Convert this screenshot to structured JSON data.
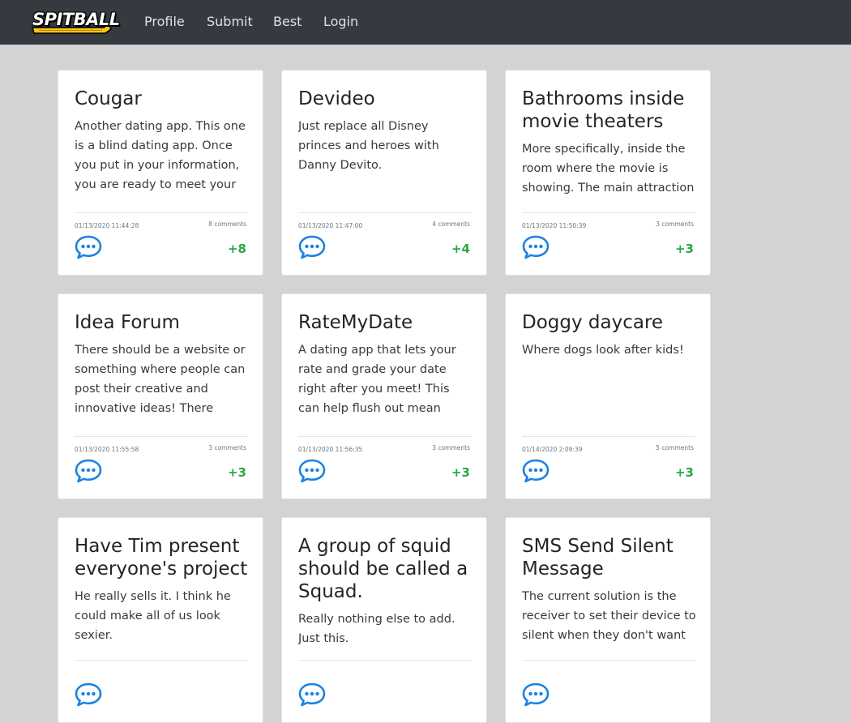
{
  "nav": {
    "logo_text": "SPITBALL",
    "links": [
      "Profile",
      "Submit",
      "Best",
      "Login"
    ]
  },
  "colors": {
    "navbar": "#343a40",
    "background": "#d3d3d3",
    "accent_blue": "#1a82e2",
    "score_green": "#28a745",
    "logo_yellow": "#f5c518"
  },
  "cards": [
    {
      "title": "Cougar",
      "text": "Another dating app. This one is a blind dating app. Once you put in your information, you are ready to meet your",
      "date": "01/13/2020 11:44:28",
      "comments": "8 comments",
      "score": "+8"
    },
    {
      "title": "Devideo",
      "text": "Just replace all Disney princes and heroes with Danny Devito.",
      "date": "01/13/2020 11:47:00",
      "comments": "4 comments",
      "score": "+4"
    },
    {
      "title": "Bathrooms inside movie theaters",
      "text": "More specifically, inside the room where the movie is showing. The main attraction",
      "date": "01/13/2020 11:50:39",
      "comments": "3 comments",
      "score": "+3"
    },
    {
      "title": "Idea Forum",
      "text": "There should be a website or something where people can post their creative and innovative ideas! There would",
      "date": "01/13/2020 11:55:58",
      "comments": "3 comments",
      "score": "+3"
    },
    {
      "title": "RateMyDate",
      "text": "A dating app that lets your rate and grade your date right after you meet! This can help flush out mean people or",
      "date": "01/13/2020 11:56:35",
      "comments": "3 comments",
      "score": "+3"
    },
    {
      "title": "Doggy daycare",
      "text": "Where dogs look after kids!",
      "date": "01/14/2020 2:09:39",
      "comments": "5 comments",
      "score": "+3"
    },
    {
      "title": "Have Tim present everyone's project",
      "text": "He really sells it. I think he could make all of us look sexier.",
      "date": "",
      "comments": "",
      "score": ""
    },
    {
      "title": "A group of squid should be called a Squad.",
      "text": "Really nothing else to add. Just this.",
      "date": "",
      "comments": "",
      "score": ""
    },
    {
      "title": "SMS Send Silent Message",
      "text": "The current solution is the receiver to set their device to silent when they don't want to",
      "date": "",
      "comments": "",
      "score": ""
    }
  ]
}
